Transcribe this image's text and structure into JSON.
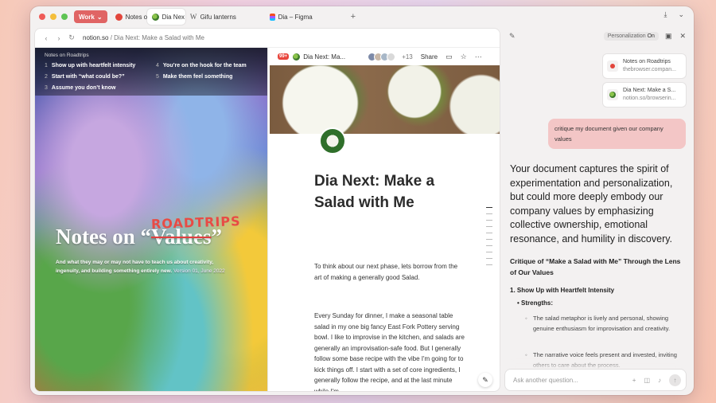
{
  "tabbar": {
    "workspace": "Work",
    "tabs": [
      {
        "label": "Notes o",
        "icon": "red-dot-icon"
      },
      {
        "label": "Dia Nex",
        "icon": "salad-icon"
      },
      {
        "label": "Gifu lanterns",
        "icon": "wikipedia-icon"
      },
      {
        "label": "Dia – Figma",
        "icon": "figma-icon"
      }
    ],
    "new_tab": "+",
    "download_icon": "⤓",
    "chevron_icon": "⌄"
  },
  "urlbar": {
    "domain": "notion.so",
    "path": " / Dia Next: Make a Salad with Me"
  },
  "left_doc": {
    "toc_title": "Notes on Roadtrips",
    "toc_left": [
      {
        "n": "1",
        "label": "Show up with heartfelt intensity"
      },
      {
        "n": "2",
        "label": "Start with “what could be?”"
      },
      {
        "n": "3",
        "label": "Assume you don’t know"
      }
    ],
    "toc_right": [
      {
        "n": "4",
        "label": "You’re on the hook for the team"
      },
      {
        "n": "5",
        "label": "Make them feel something"
      }
    ],
    "hero_prefix": "Notes on “",
    "hero_struck": "Values",
    "hero_suffix": "”",
    "hero_overlay": "ROADTRIPS",
    "hero_sub": "And what they may or may not have to teach us about creativity, ingenuity, and building something entirely new.",
    "hero_version": "Version 01, June 2022"
  },
  "mid_doc": {
    "badge": "99+",
    "title": "Dia Next: Ma...",
    "collaborators": "+13",
    "share": "Share",
    "doc_title": "Dia Next: Make a Salad with Me",
    "para1": "To think about our next phase, lets borrow from the art of making a generally good Salad.",
    "para2": "Every Sunday for dinner, I make a seasonal table salad in my one big fancy East Fork Pottery serving bowl. I like to improvise in the kitchen, and salads are generally an improvisation-safe food. But I generally follow some base recipe with the vibe I'm going for to kick things off. I start with a set of core ingredients, I generally follow the recipe, and at the last minute while I'm"
  },
  "sidebar": {
    "personalization_label": "Personalization",
    "personalization_state": "On",
    "context": [
      {
        "title": "Notes on Roadtrips",
        "sub": "thebrowser.compan..."
      },
      {
        "title": "Dia Next: Make a S...",
        "sub": "notion.so/browserin..."
      }
    ],
    "user_msg": "critique my document given our company values",
    "answer": "Your document captures the spirit of experimentation and personalization, but could more deeply embody our company values by emphasizing collective ownership, emotional resonance, and humility in discovery.",
    "critique_heading": "Critique of “Make a Salad with Me” Through the Lens of Our Values",
    "section1": "1. Show Up with Heartfelt Intensity",
    "strengths": "Strengths:",
    "bullets": [
      "The salad metaphor is lively and personal, showing genuine enthusiasm for improvisation and creativity.",
      "The narrative voice feels present and invested, inviting others to care about the process."
    ],
    "ask_placeholder": "Ask another question...",
    "ask_plus": "+",
    "send_icon": "↑"
  },
  "colors": {
    "work_pill": "#e06464",
    "user_bubble": "#f3c6c6",
    "window_bg": "#f3f1f1"
  }
}
